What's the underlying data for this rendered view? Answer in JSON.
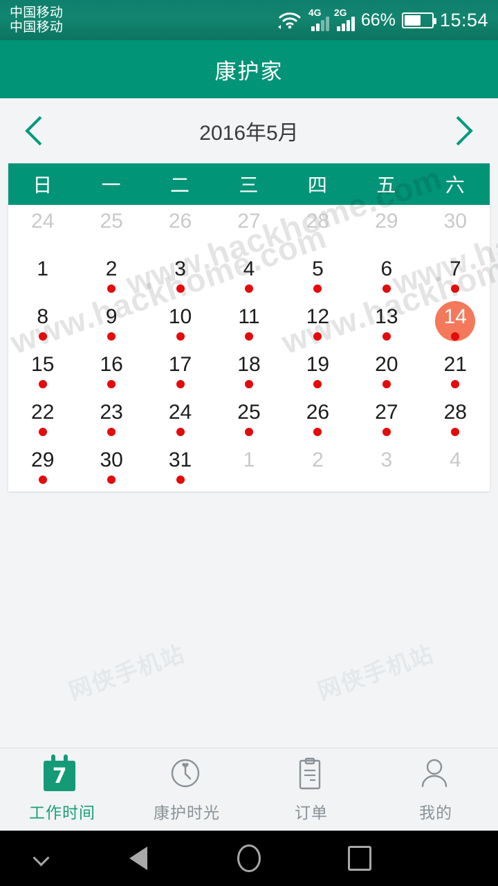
{
  "status_bar": {
    "carrier_line1": "中国移动",
    "carrier_line2": "中国移动",
    "network_label_1": "4G",
    "network_label_2": "2G",
    "battery_percent": "66%",
    "time": "15:54",
    "wifi_icon": "wifi-icon",
    "battery_icon": "battery-icon"
  },
  "header": {
    "title": "康护家"
  },
  "month_nav": {
    "prev_icon": "chevron-left-icon",
    "next_icon": "chevron-right-icon",
    "month_label": "2016年5月"
  },
  "calendar": {
    "weekdays": [
      "日",
      "一",
      "二",
      "三",
      "四",
      "五",
      "六"
    ],
    "selected_day": 14,
    "accent_header": "#019477",
    "selected_bg": "#f4795b",
    "dot_color": "#e30b0b",
    "cells": [
      {
        "label": "24",
        "muted": true,
        "dot": false
      },
      {
        "label": "25",
        "muted": true,
        "dot": false
      },
      {
        "label": "26",
        "muted": true,
        "dot": false
      },
      {
        "label": "27",
        "muted": true,
        "dot": false
      },
      {
        "label": "28",
        "muted": true,
        "dot": false
      },
      {
        "label": "29",
        "muted": true,
        "dot": false
      },
      {
        "label": "30",
        "muted": true,
        "dot": false
      },
      {
        "label": "1",
        "muted": false,
        "dot": false
      },
      {
        "label": "2",
        "muted": false,
        "dot": true
      },
      {
        "label": "3",
        "muted": false,
        "dot": true
      },
      {
        "label": "4",
        "muted": false,
        "dot": true
      },
      {
        "label": "5",
        "muted": false,
        "dot": true
      },
      {
        "label": "6",
        "muted": false,
        "dot": true
      },
      {
        "label": "7",
        "muted": false,
        "dot": true
      },
      {
        "label": "8",
        "muted": false,
        "dot": true
      },
      {
        "label": "9",
        "muted": false,
        "dot": true
      },
      {
        "label": "10",
        "muted": false,
        "dot": true
      },
      {
        "label": "11",
        "muted": false,
        "dot": true
      },
      {
        "label": "12",
        "muted": false,
        "dot": true
      },
      {
        "label": "13",
        "muted": false,
        "dot": true
      },
      {
        "label": "14",
        "muted": false,
        "dot": true,
        "selected": true
      },
      {
        "label": "15",
        "muted": false,
        "dot": true
      },
      {
        "label": "16",
        "muted": false,
        "dot": true
      },
      {
        "label": "17",
        "muted": false,
        "dot": true
      },
      {
        "label": "18",
        "muted": false,
        "dot": true
      },
      {
        "label": "19",
        "muted": false,
        "dot": true
      },
      {
        "label": "20",
        "muted": false,
        "dot": true
      },
      {
        "label": "21",
        "muted": false,
        "dot": true
      },
      {
        "label": "22",
        "muted": false,
        "dot": true
      },
      {
        "label": "23",
        "muted": false,
        "dot": true
      },
      {
        "label": "24",
        "muted": false,
        "dot": true
      },
      {
        "label": "25",
        "muted": false,
        "dot": true
      },
      {
        "label": "26",
        "muted": false,
        "dot": true
      },
      {
        "label": "27",
        "muted": false,
        "dot": true
      },
      {
        "label": "28",
        "muted": false,
        "dot": true
      },
      {
        "label": "29",
        "muted": false,
        "dot": true
      },
      {
        "label": "30",
        "muted": false,
        "dot": true
      },
      {
        "label": "31",
        "muted": false,
        "dot": true
      },
      {
        "label": "1",
        "muted": true,
        "dot": false
      },
      {
        "label": "2",
        "muted": true,
        "dot": false
      },
      {
        "label": "3",
        "muted": true,
        "dot": false
      },
      {
        "label": "4",
        "muted": true,
        "dot": false
      }
    ]
  },
  "watermarks": {
    "primary": "www.hackhome.com",
    "secondary": "网侠手机站"
  },
  "tabbar": {
    "tabs": [
      {
        "label": "工作时间",
        "icon": "calendar-icon",
        "active": true
      },
      {
        "label": "康护时光",
        "icon": "clock-heart-icon",
        "active": false
      },
      {
        "label": "订单",
        "icon": "clipboard-icon",
        "active": false
      },
      {
        "label": "我的",
        "icon": "person-icon",
        "active": false
      }
    ],
    "active_color": "#1aa179",
    "inactive_color": "#8a9196"
  },
  "navbar": {
    "hide_icon": "chevron-down-icon",
    "back_icon": "back-triangle-icon",
    "home_icon": "home-circle-icon",
    "recents_icon": "recents-square-icon"
  }
}
